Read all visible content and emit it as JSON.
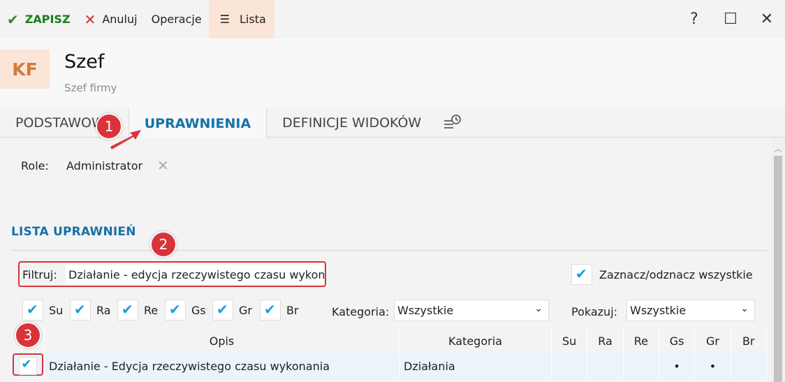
{
  "toolbar": {
    "save_label": "ZAPISZ",
    "cancel_label": "Anuluj",
    "operations_label": "Operacje",
    "list_label": "Lista"
  },
  "window": {
    "help": "?",
    "maximize": "☐",
    "close": "✕"
  },
  "header": {
    "avatar": "KF",
    "title": "Szef",
    "subtitle": "Szef firmy"
  },
  "tabs": [
    {
      "label": "PODSTAWOWE"
    },
    {
      "label": "UPRAWNIENIA"
    },
    {
      "label": "DEFINICJE WIDOKÓW"
    }
  ],
  "role": {
    "label": "Role:",
    "value": "Administrator"
  },
  "section_title": "LISTA UPRAWNIEŃ",
  "filter": {
    "label": "Filtruj:",
    "value": "Działanie - edycja rzeczywistego czasu wykona"
  },
  "select_all_label": "Zaznacz/odznacz wszystkie",
  "flags": [
    {
      "label": "Su"
    },
    {
      "label": "Ra"
    },
    {
      "label": "Re"
    },
    {
      "label": "Gs"
    },
    {
      "label": "Gr"
    },
    {
      "label": "Br"
    }
  ],
  "category_filter": {
    "label": "Kategoria:",
    "value": "Wszystkie"
  },
  "show_filter": {
    "label": "Pokazuj:",
    "value": "Wszystkie"
  },
  "table": {
    "columns": [
      "Opis",
      "Kategoria",
      "Su",
      "Ra",
      "Re",
      "Gs",
      "Gr",
      "Br"
    ],
    "rows": [
      {
        "opis": "Działanie - Edycja rzeczywistego czasu wykonania",
        "kategoria": "Działania",
        "su": "",
        "ra": "",
        "re": "",
        "gs": "•",
        "gr": "•",
        "br": ""
      }
    ]
  },
  "annotations": [
    "1",
    "2",
    "3"
  ],
  "colors": {
    "accent": "#1472a8",
    "highlight": "#d9333a",
    "check": "#1a9be0",
    "avatar_bg": "#fbe5d6"
  }
}
